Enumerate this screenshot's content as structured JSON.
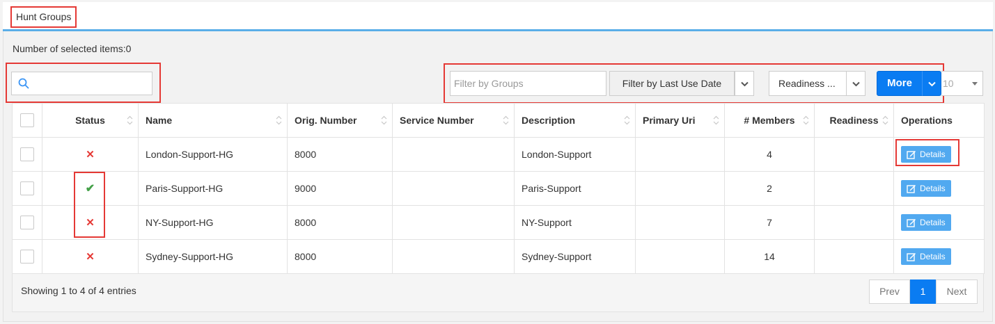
{
  "page": {
    "title": "Hunt Groups",
    "selected_count": "Number of selected items:0"
  },
  "search": {
    "placeholder": ""
  },
  "filters": {
    "groups_placeholder": "Filter by Groups",
    "date_label": "Filter by Last Use Date",
    "readiness_label": "Readiness ...",
    "more_label": "More",
    "page_size": "10"
  },
  "table": {
    "headers": {
      "status": "Status",
      "name": "Name",
      "orig_number": "Orig. Number",
      "service_number": "Service Number",
      "description": "Description",
      "primary_uri": "Primary Uri",
      "members": "# Members",
      "readiness": "Readiness",
      "operations": "Operations"
    },
    "rows": [
      {
        "status": "error",
        "status_glyph": "✕",
        "name": "London-Support-HG",
        "orig_number": "8000",
        "service_number": "",
        "description": "London-Support",
        "primary_uri": "",
        "members": "4",
        "readiness": "",
        "details": "Details"
      },
      {
        "status": "ok",
        "status_glyph": "✔",
        "name": "Paris-Support-HG",
        "orig_number": "9000",
        "service_number": "",
        "description": "Paris-Support",
        "primary_uri": "",
        "members": "2",
        "readiness": "",
        "details": "Details"
      },
      {
        "status": "error",
        "status_glyph": "✕",
        "name": "NY-Support-HG",
        "orig_number": "8000",
        "service_number": "",
        "description": "NY-Support",
        "primary_uri": "",
        "members": "7",
        "readiness": "",
        "details": "Details"
      },
      {
        "status": "error",
        "status_glyph": "✕",
        "name": "Sydney-Support-HG",
        "orig_number": "8000",
        "service_number": "",
        "description": "Sydney-Support",
        "primary_uri": "",
        "members": "14",
        "readiness": "",
        "details": "Details"
      }
    ]
  },
  "footer": {
    "showing": "Showing 1 to 4 of 4 entries",
    "prev": "Prev",
    "current_page": "1",
    "next": "Next"
  },
  "colors": {
    "accent": "#0a7cf2",
    "details": "#51a9f0",
    "error": "#e53935",
    "ok": "#43a047",
    "highlight": "#e53935"
  }
}
